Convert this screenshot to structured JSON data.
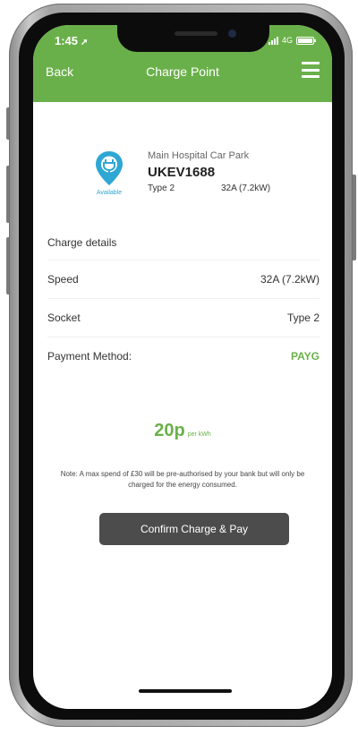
{
  "status_bar": {
    "time": "1:45",
    "location_arrow": "➚",
    "network": "4G",
    "battery_level": 1.0
  },
  "header": {
    "back_label": "Back",
    "title": "Charge Point",
    "menu_icon": "hamburger-icon",
    "background_color": "#6ab04a"
  },
  "charge_point": {
    "icon": "ev-charger-pin-icon",
    "status": "Available",
    "location": "Main Hospital Car Park",
    "id": "UKEV1688",
    "connector_type": "Type 2",
    "power": "32A (7.2kW)",
    "pin_color": "#2fa7d4"
  },
  "details": {
    "heading": "Charge details",
    "rows": [
      {
        "label": "Speed",
        "value": "32A (7.2kW)"
      },
      {
        "label": "Socket",
        "value": "Type 2"
      },
      {
        "label": "Payment Method:",
        "value": "PAYG"
      }
    ]
  },
  "pricing": {
    "amount": "20p",
    "unit": "per kWh",
    "accent_color": "#6ab04a"
  },
  "note": "Note: A max spend of £30 will be pre-authorised by your bank but will only be charged for the energy consumed.",
  "confirm_button": {
    "label": "Confirm Charge & Pay"
  }
}
